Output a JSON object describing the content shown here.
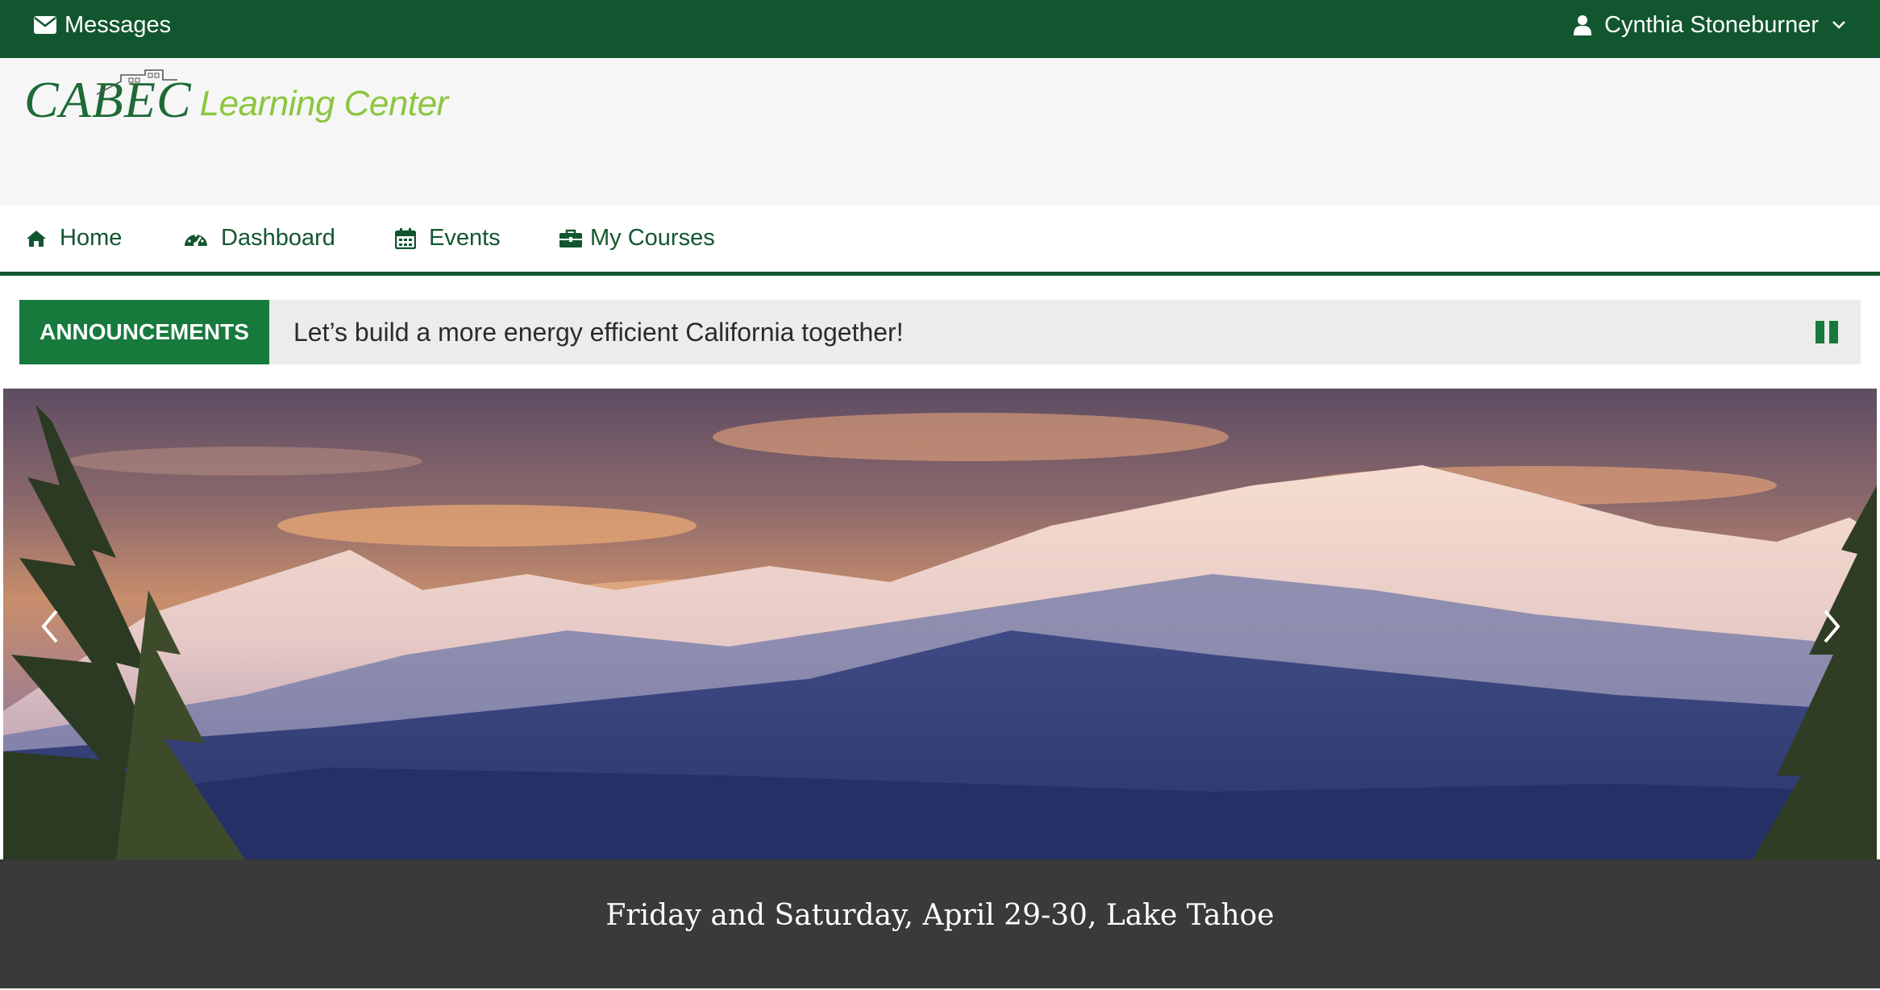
{
  "topbar": {
    "messages_label": "Messages",
    "user_name": "Cynthia Stoneburner"
  },
  "logo": {
    "main_text": "CABEC",
    "sub_text": "Learning Center"
  },
  "nav": {
    "items": [
      {
        "label": "Home",
        "icon": "home-icon"
      },
      {
        "label": "Dashboard",
        "icon": "dashboard-icon"
      },
      {
        "label": "Events",
        "icon": "calendar-icon"
      },
      {
        "label": "My Courses",
        "icon": "briefcase-icon"
      }
    ]
  },
  "announcements": {
    "label": "ANNOUNCEMENTS",
    "text": "Let’s build a more energy efficient California together!"
  },
  "slider": {
    "caption": "Friday and Saturday, April 29-30, Lake Tahoe",
    "image": "snow-capped mountain range at sunset with pine trees"
  },
  "colors": {
    "topbar_bg": "#12562f",
    "brand_green": "#1d6a36",
    "logo_light_green": "#8cc63f",
    "announcement_green": "#177a3c",
    "caption_bg": "#3a3a3a"
  }
}
